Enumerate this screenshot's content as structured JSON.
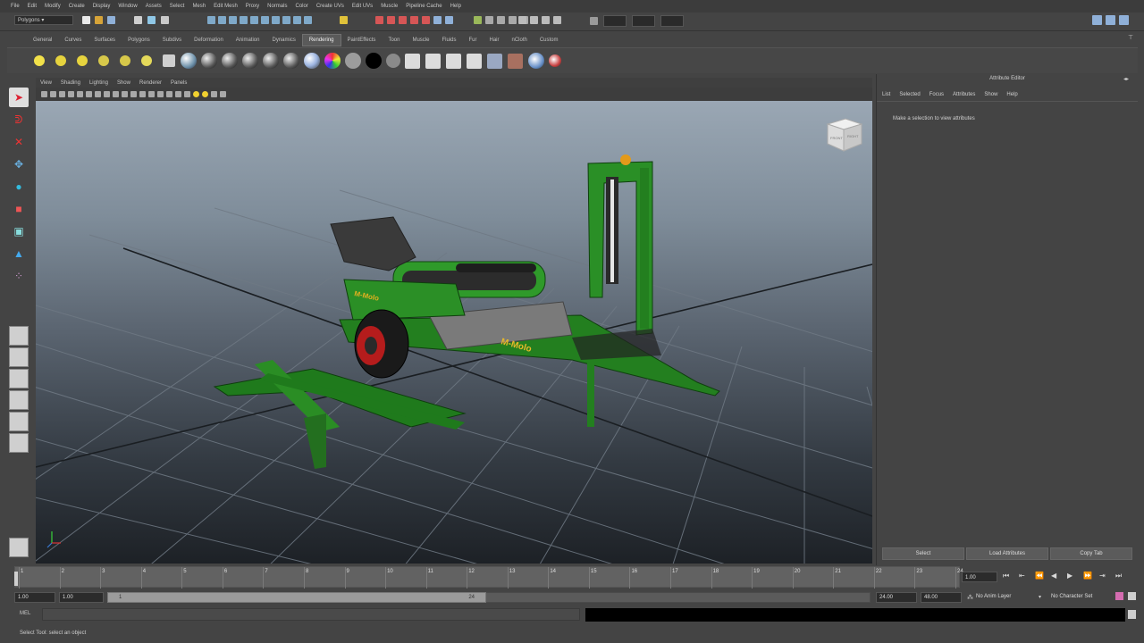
{
  "menubar": [
    "File",
    "Edit",
    "Modify",
    "Create",
    "Display",
    "Window",
    "Assets",
    "Select",
    "Mesh",
    "Edit Mesh",
    "Proxy",
    "Normals",
    "Color",
    "Create UVs",
    "Edit UVs",
    "Muscle",
    "Pipeline Cache",
    "Help"
  ],
  "status": {
    "mode": "Polygons"
  },
  "shelf": {
    "tabs": [
      "General",
      "Curves",
      "Surfaces",
      "Polygons",
      "Subdivs",
      "Deformation",
      "Animation",
      "Dynamics",
      "Rendering",
      "PaintEffects",
      "Toon",
      "Muscle",
      "Fluids",
      "Fur",
      "Hair",
      "nCloth",
      "Custom"
    ],
    "active_tab": "Rendering"
  },
  "viewport": {
    "menu": [
      "View",
      "Shading",
      "Lighting",
      "Show",
      "Renderer",
      "Panels"
    ],
    "model_label": "M-Molo",
    "viewcube_labels": [
      "FRONT",
      "RIGHT"
    ]
  },
  "attribute_editor": {
    "title": "Attribute Editor",
    "menu": [
      "List",
      "Selected",
      "Focus",
      "Attributes",
      "Show",
      "Help"
    ],
    "message": "Make a selection to view attributes",
    "buttons": [
      "Select",
      "Load Attributes",
      "Copy Tab"
    ]
  },
  "timeline": {
    "ticks": [
      "1",
      "2",
      "3",
      "4",
      "5",
      "6",
      "7",
      "8",
      "9",
      "10",
      "11",
      "12",
      "13",
      "14",
      "15",
      "16",
      "17",
      "18",
      "19",
      "20",
      "21",
      "22",
      "23",
      "24"
    ],
    "current": "1.00"
  },
  "range": {
    "start": "1.00",
    "playback_start": "1.00",
    "thumb_start": "1",
    "thumb_end": "24",
    "playback_end": "24.00",
    "end": "48.00",
    "anim_layer": "No Anim Layer",
    "character_set": "No Character Set"
  },
  "command": {
    "label": "MEL"
  },
  "help_line": "Select Tool: select an object"
}
